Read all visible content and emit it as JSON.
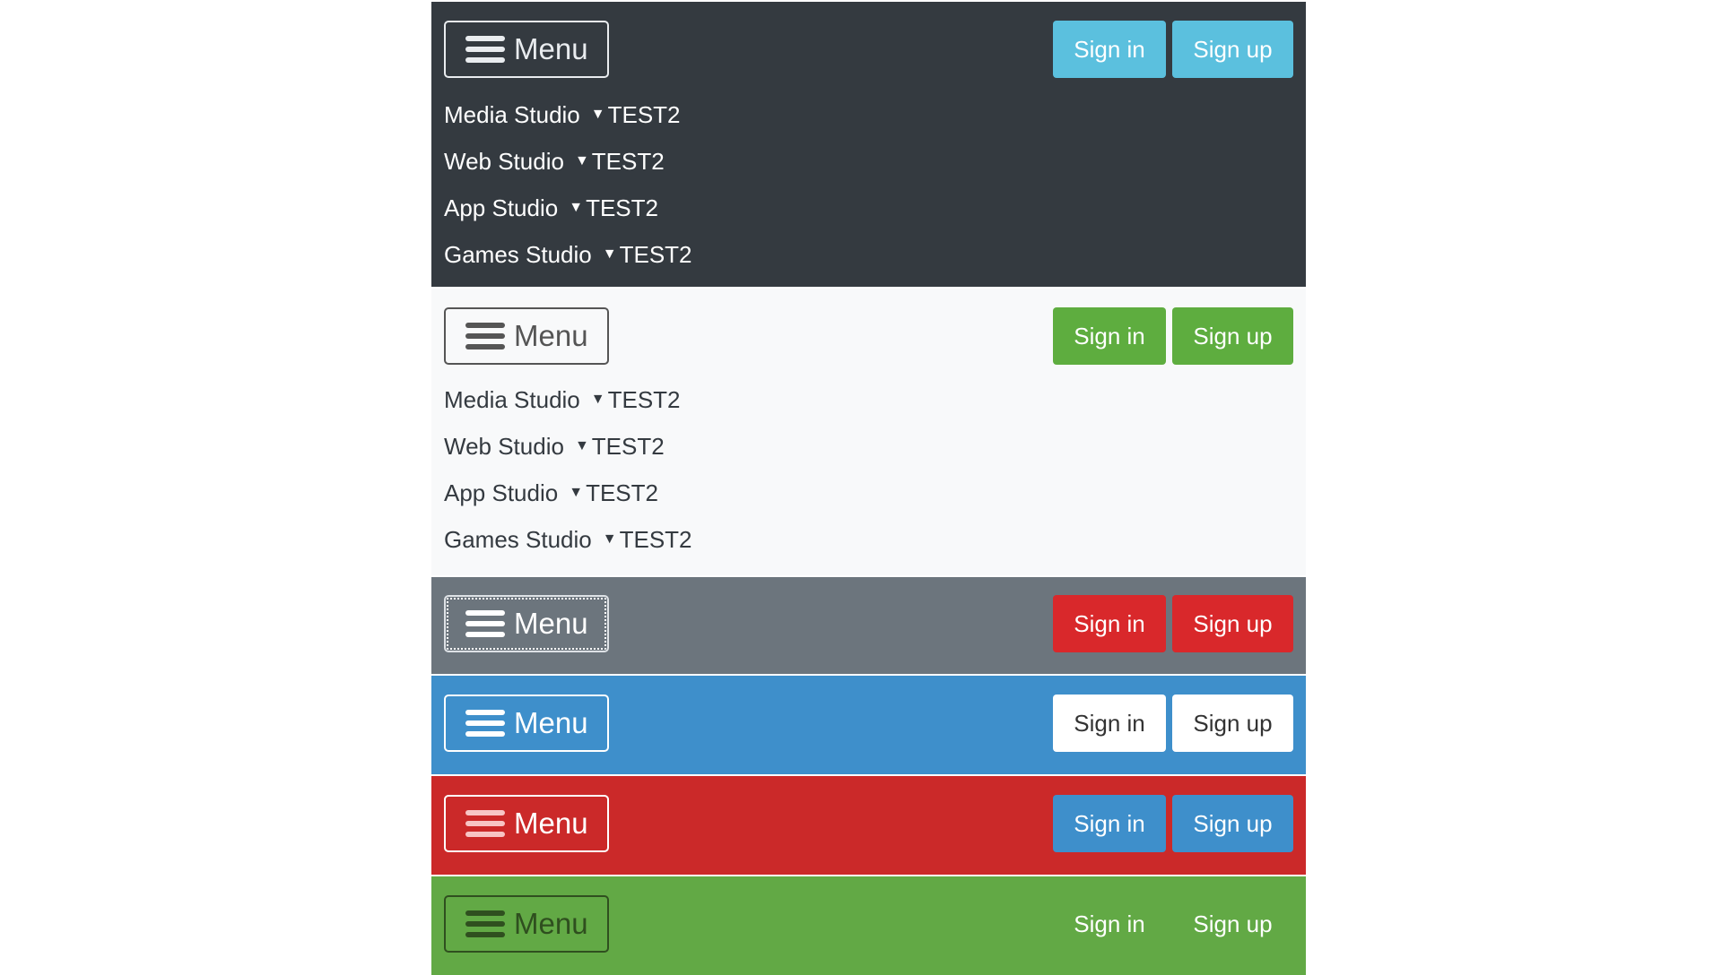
{
  "menu_label": "Menu",
  "signin_label": "Sign in",
  "signup_label": "Sign up",
  "nav_items": [
    {
      "label": "Media Studio",
      "caret": "▼",
      "sub": "TEST2"
    },
    {
      "label": "Web Studio",
      "caret": "▼",
      "sub": "TEST2"
    },
    {
      "label": "App Studio",
      "caret": "▼",
      "sub": "TEST2"
    },
    {
      "label": "Games Studio",
      "caret": "▼",
      "sub": "TEST2"
    }
  ],
  "themes": [
    {
      "name": "dark",
      "background": "#343a40",
      "button_color": "#5bc0de"
    },
    {
      "name": "light",
      "background": "#f8f9fa",
      "button_color": "#5ead3f"
    },
    {
      "name": "gray",
      "background": "#6c757d",
      "button_color": "#d9282b"
    },
    {
      "name": "blue",
      "background": "#3e8fcb",
      "button_color": "#ffffff"
    },
    {
      "name": "red",
      "background": "#cb2929",
      "button_color": "#3e8fcb"
    },
    {
      "name": "green",
      "background": "#62a945",
      "button_color": "transparent"
    }
  ],
  "icons": {
    "menu_toggle": "hamburger-icon",
    "nav_dropdown": "caret-down-icon"
  }
}
